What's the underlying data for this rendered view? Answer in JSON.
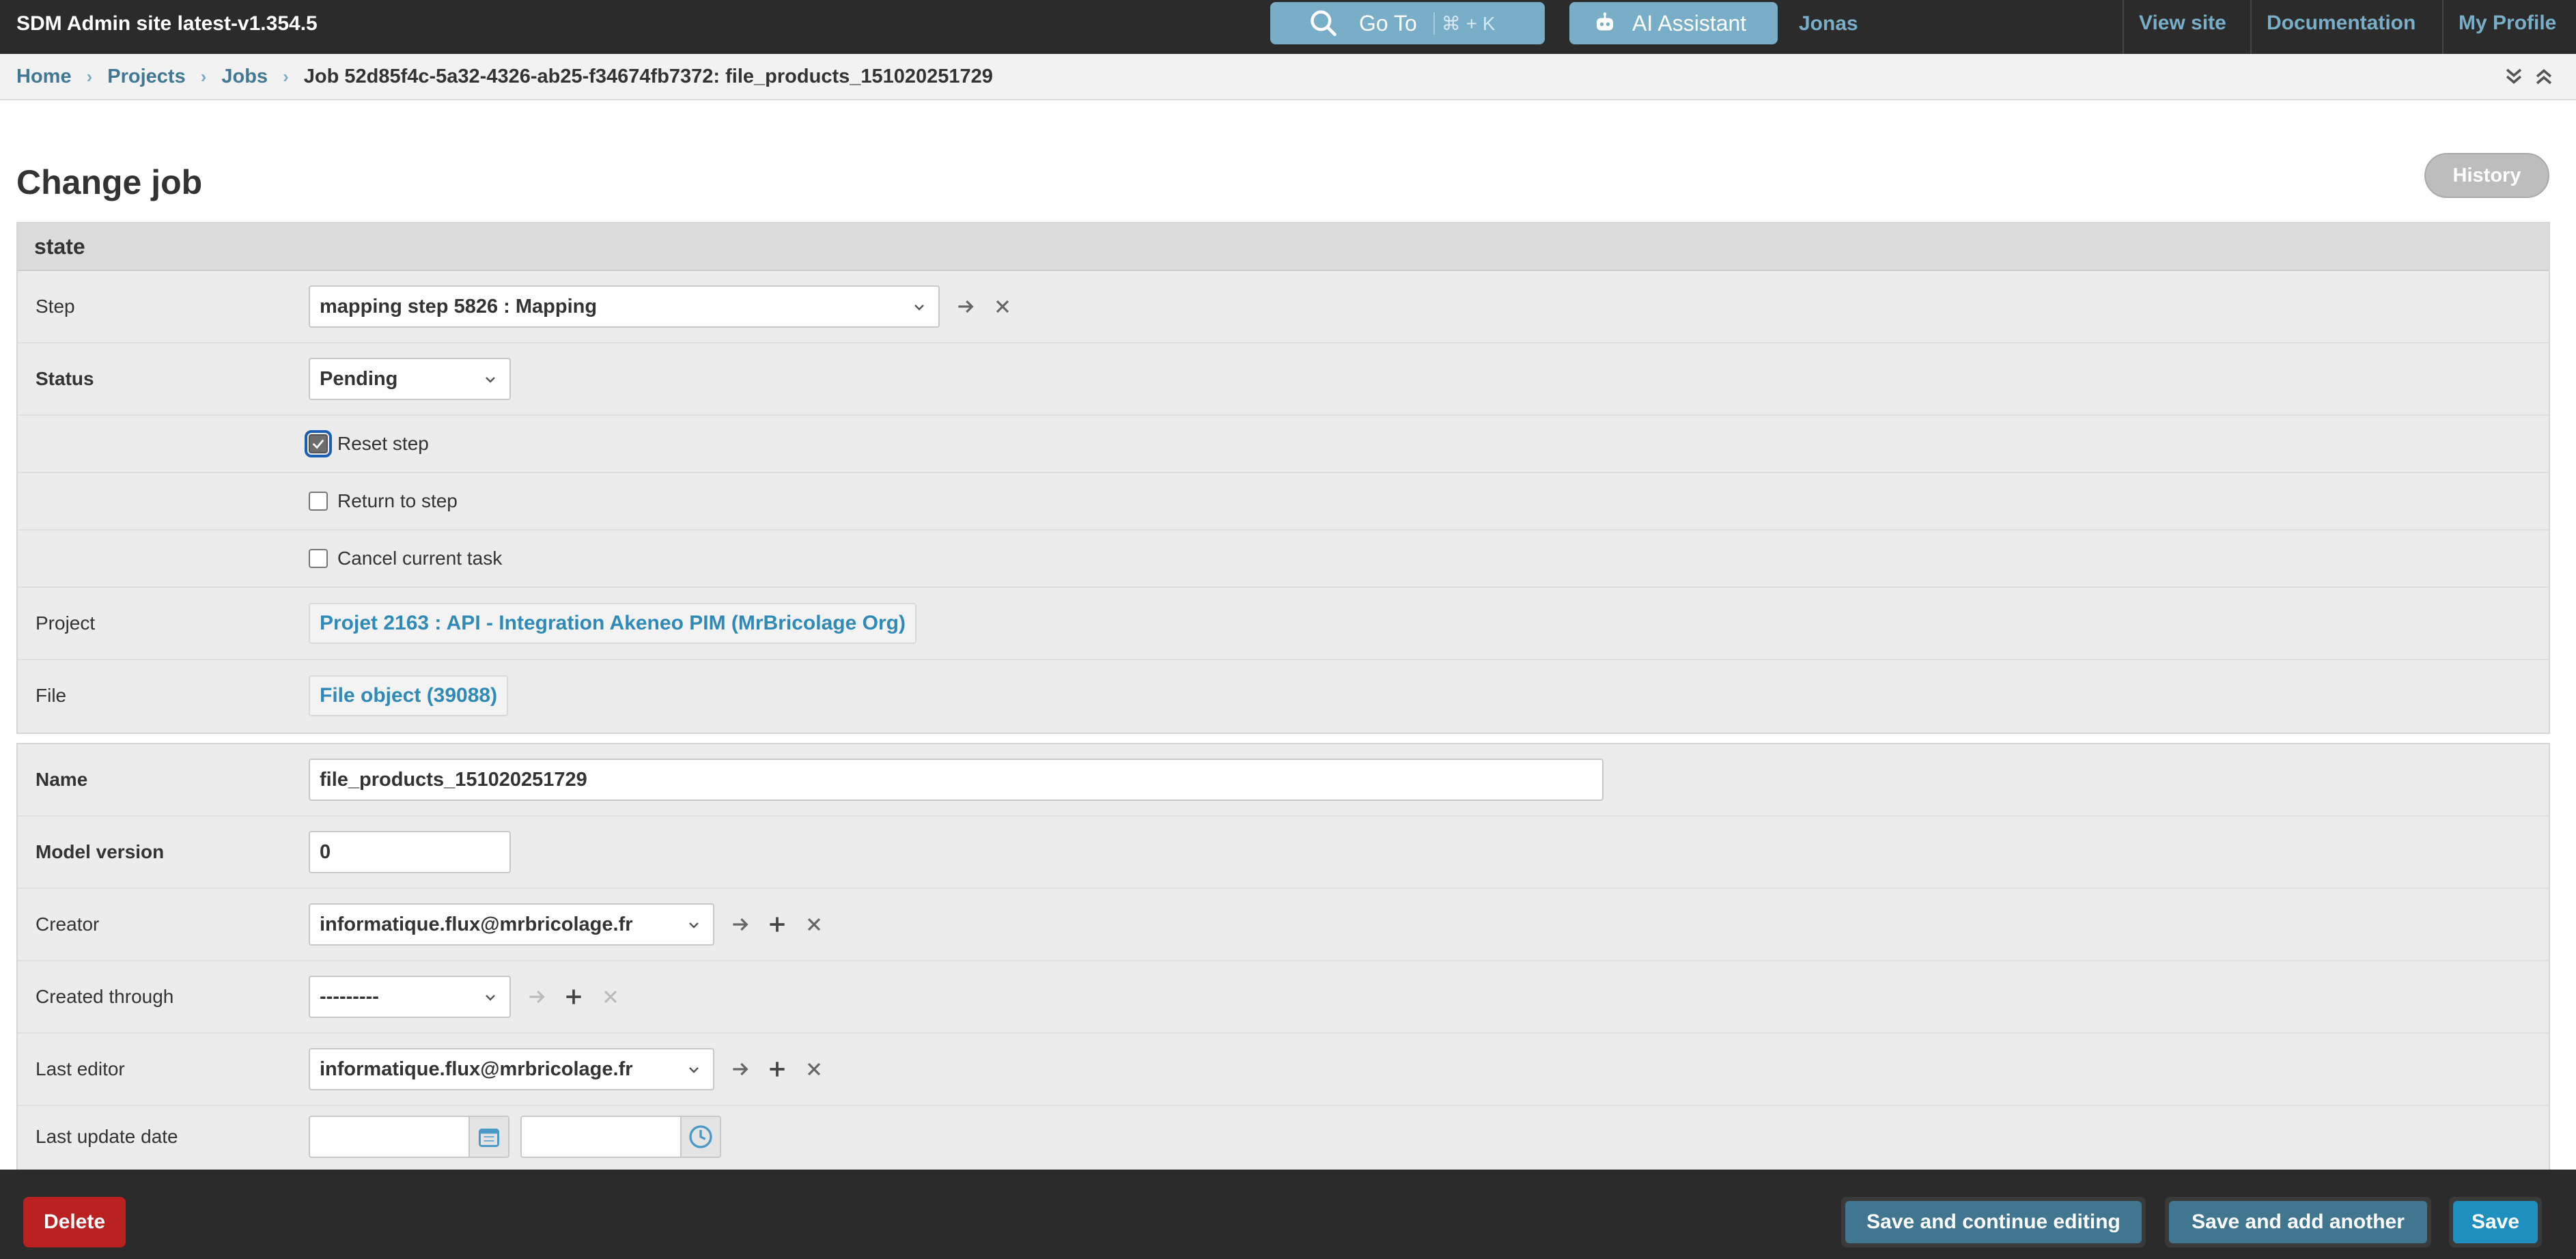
{
  "header": {
    "site_title": "SDM Admin site latest-v1.354.5",
    "goto_label": "Go To",
    "goto_shortcut": "⌘ + K",
    "ai_label": "AI Assistant",
    "user_name": "Jonas",
    "links": [
      "View site",
      "Documentation",
      "My Profile"
    ]
  },
  "breadcrumbs": [
    "Home",
    "Projects",
    "Jobs"
  ],
  "breadcrumb_current": "Job 52d85f4c-5a32-4326-ab25-f34674fb7372: file_products_151020251729",
  "page": {
    "title": "Change job",
    "history_label": "History"
  },
  "state_section": {
    "header": "state",
    "step_label": "Step",
    "step_value": "mapping step 5826 : Mapping",
    "status_label": "Status",
    "status_value": "Pending",
    "reset_step_label": "Reset step",
    "reset_step_checked": true,
    "return_to_step_label": "Return to step",
    "cancel_task_label": "Cancel current task",
    "project_label": "Project",
    "project_value": "Projet 2163 : API - Integration Akeneo PIM (MrBricolage Org)",
    "file_label": "File",
    "file_value": "File object (39088)"
  },
  "main_section": {
    "name_label": "Name",
    "name_value": "file_products_151020251729",
    "model_version_label": "Model version",
    "model_version_value": "0",
    "creator_label": "Creator",
    "creator_value": "informatique.flux@mrbricolage.fr",
    "created_through_label": "Created through",
    "created_through_value": "---------",
    "last_editor_label": "Last editor",
    "last_editor_value": "informatique.flux@mrbricolage.fr",
    "last_update_label": "Last update date"
  },
  "footer": {
    "delete_label": "Delete",
    "save_continue_label": "Save and continue editing",
    "save_add_label": "Save and add another",
    "save_label": "Save"
  },
  "colors": {
    "header_bg": "#2b2b2b",
    "accent": "#79aec8",
    "link": "#417893",
    "delete": "#ba2121",
    "save": "#417690"
  }
}
